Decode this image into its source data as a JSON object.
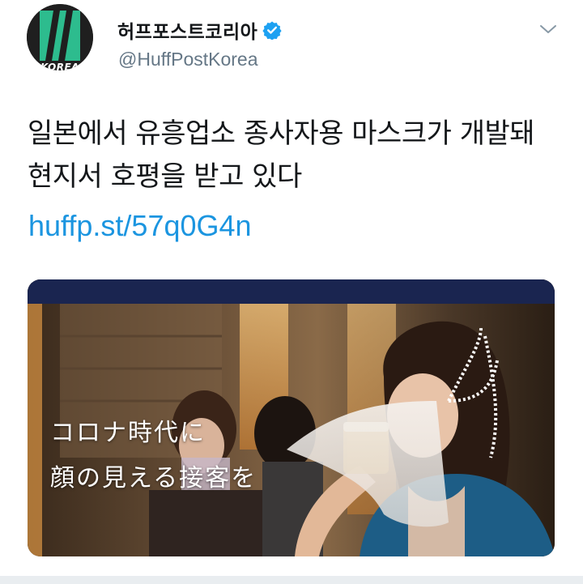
{
  "account": {
    "avatar_text": "KOREA",
    "display_name": "허프포스트코리아",
    "verified_icon": "verified-badge-icon",
    "handle": "@HuffPostKorea",
    "menu_icon": "chevron-down-icon"
  },
  "tweet": {
    "text": "일본에서 유흥업소 종사자용 마스크가 개발돼 현지서 호평을 받고 있다",
    "link": "huffp.st/57q0G4n"
  },
  "media": {
    "caption_line1": "コロナ時代に",
    "caption_line2": "顔の見える接客を"
  },
  "colors": {
    "brand_green": "#2dbc8e",
    "verified_blue": "#1da1f2",
    "link_blue": "#1b95e0",
    "header_band": "#1a2550"
  }
}
